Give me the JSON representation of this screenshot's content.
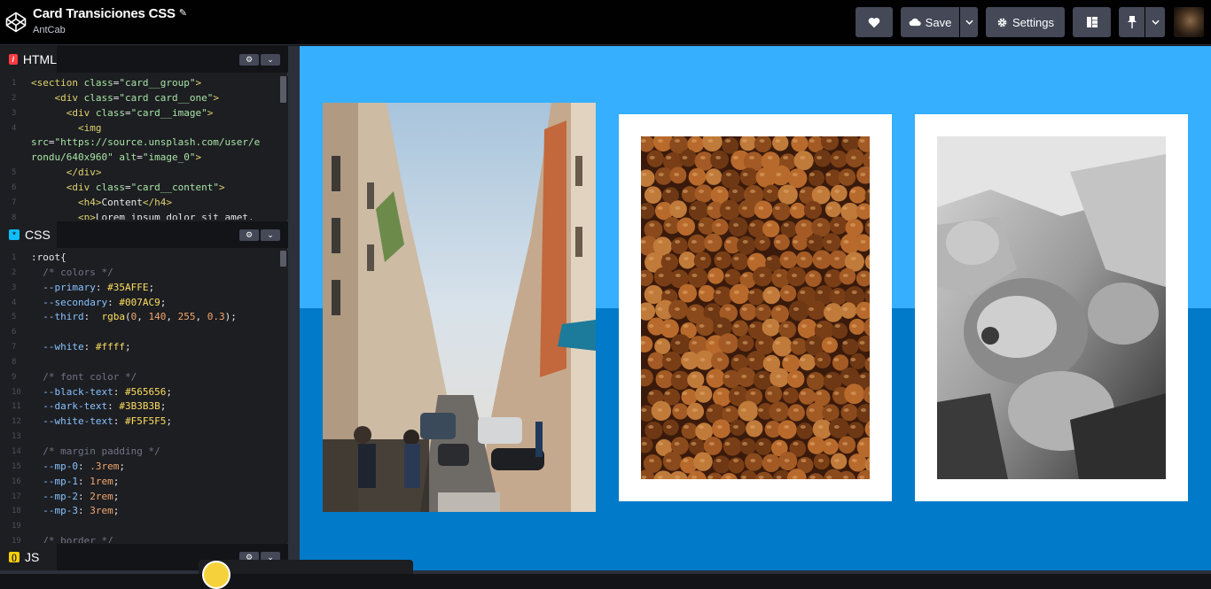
{
  "header": {
    "title": "Card Transiciones CSS",
    "author": "AntCab",
    "save_label": "Save",
    "settings_label": "Settings"
  },
  "editors": {
    "html": {
      "label": "HTML",
      "lines": [
        {
          "n": "1",
          "html": "<span class='t-tag'>&lt;section</span> <span class='t-attr'>class</span>=<span class='t-str'>\"card__group\"</span><span class='t-tag'>&gt;</span>"
        },
        {
          "n": "2",
          "html": "    <span class='t-tag'>&lt;div</span> <span class='t-attr'>class</span>=<span class='t-str'>\"card card__one\"</span><span class='t-tag'>&gt;</span>"
        },
        {
          "n": "3",
          "html": "      <span class='t-tag'>&lt;div</span> <span class='t-attr'>class</span>=<span class='t-str'>\"card__image\"</span><span class='t-tag'>&gt;</span>"
        },
        {
          "n": "4",
          "html": "        <span class='t-tag'>&lt;img</span>"
        },
        {
          "n": "",
          "html": "<span class='t-attr'>src</span>=<span class='t-str'>\"https://source.unsplash.com/user/e</span>"
        },
        {
          "n": "",
          "html": "<span class='t-str'>rondu/640x960\"</span> <span class='t-attr'>alt</span>=<span class='t-str'>\"image_0\"</span><span class='t-tag'>&gt;</span>"
        },
        {
          "n": "5",
          "html": "      <span class='t-tag'>&lt;/div&gt;</span>"
        },
        {
          "n": "6",
          "html": "      <span class='t-tag'>&lt;div</span> <span class='t-attr'>class</span>=<span class='t-str'>\"card__content\"</span><span class='t-tag'>&gt;</span>"
        },
        {
          "n": "7",
          "html": "        <span class='t-tag'>&lt;h4&gt;</span><span class='t-txt'>Content</span><span class='t-tag'>&lt;/h4&gt;</span>"
        },
        {
          "n": "8",
          "html": "        <span class='t-tag'>&lt;p&gt;</span><span class='t-txt'>Lorem ipsum dolor sit amet,</span>"
        }
      ]
    },
    "css": {
      "label": "CSS",
      "lines": [
        {
          "n": "1",
          "html": "<span class='t-sel'>:root{</span>"
        },
        {
          "n": "2",
          "html": "  <span class='t-cm'>/* colors */</span>"
        },
        {
          "n": "3",
          "html": "  <span class='t-prop'>--primary</span>: <span class='t-val'>#35AFFE</span>;"
        },
        {
          "n": "4",
          "html": "  <span class='t-prop'>--secondary</span>: <span class='t-val'>#007AC9</span>;"
        },
        {
          "n": "5",
          "html": "  <span class='t-prop'>--third</span>:  <span class='t-val'>rgba</span>(<span class='t-num'>0</span>, <span class='t-num'>140</span>, <span class='t-num'>255</span>, <span class='t-num'>0.3</span>);"
        },
        {
          "n": "6",
          "html": ""
        },
        {
          "n": "7",
          "html": "  <span class='t-prop'>--white</span>: <span class='t-val'>#ffff</span>;"
        },
        {
          "n": "8",
          "html": ""
        },
        {
          "n": "9",
          "html": "  <span class='t-cm'>/* font color */</span>"
        },
        {
          "n": "10",
          "html": "  <span class='t-prop'>--black-text</span>: <span class='t-val'>#565656</span>;"
        },
        {
          "n": "11",
          "html": "  <span class='t-prop'>--dark-text</span>: <span class='t-val'>#3B3B3B</span>;"
        },
        {
          "n": "12",
          "html": "  <span class='t-prop'>--white-text</span>: <span class='t-val'>#F5F5F5</span>;"
        },
        {
          "n": "13",
          "html": ""
        },
        {
          "n": "14",
          "html": "  <span class='t-cm'>/* margin padding */</span>"
        },
        {
          "n": "15",
          "html": "  <span class='t-prop'>--mp-0</span>: <span class='t-num'>.3rem</span>;"
        },
        {
          "n": "16",
          "html": "  <span class='t-prop'>--mp-1</span>: <span class='t-num'>1rem</span>;"
        },
        {
          "n": "17",
          "html": "  <span class='t-prop'>--mp-2</span>: <span class='t-num'>2rem</span>;"
        },
        {
          "n": "18",
          "html": "  <span class='t-prop'>--mp-3</span>: <span class='t-num'>3rem</span>;"
        },
        {
          "n": "19",
          "html": ""
        },
        {
          "n": "19",
          "html": "  <span class='t-cm'>/* border */</span>"
        }
      ]
    },
    "js": {
      "label": "JS"
    }
  },
  "colors": {
    "primary": "#35AFFE",
    "secondary": "#007AC9",
    "html_badge": "#ff3c41",
    "css_badge": "#0ebeff",
    "js_badge": "#fcd000"
  },
  "preview": {
    "cards": [
      {
        "name": "street-photo",
        "image": "image_0"
      },
      {
        "name": "hazelnuts-photo",
        "image": "image_1"
      },
      {
        "name": "hands-photo",
        "image": "image_2"
      }
    ]
  }
}
